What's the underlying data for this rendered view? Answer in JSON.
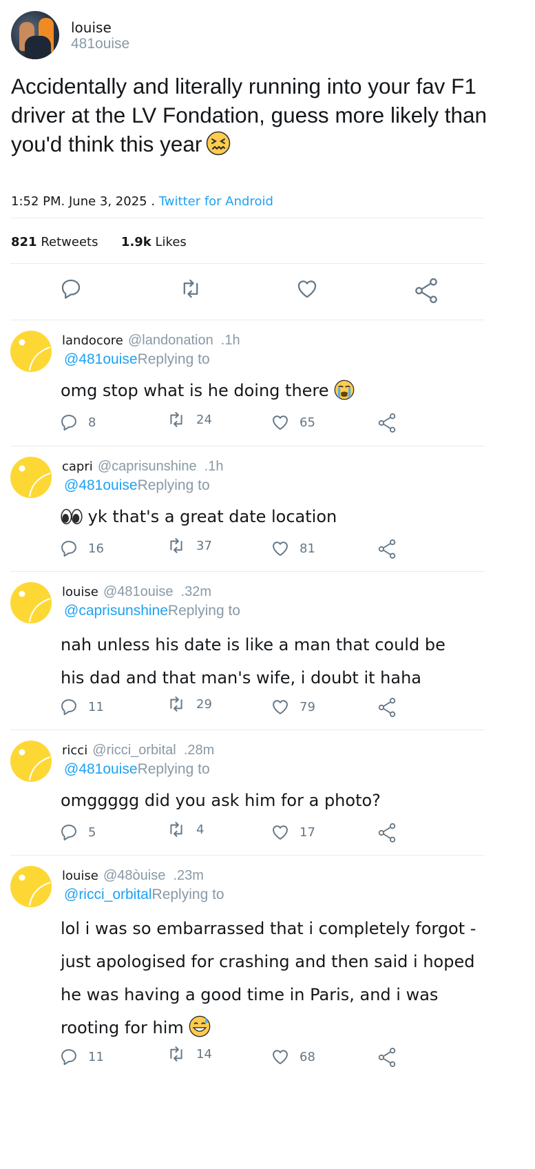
{
  "tweet": {
    "display_name": "louise",
    "handle": "481ouise",
    "text": "Accidentally and literally running into your fav F1 driver at the LV Fondation, guess more likely than you'd think this year",
    "emoji": "confounded-face-emoji",
    "timestamp": "1:52 PM. June 3, 2025 .",
    "source": "Twitter for Android",
    "retweets_count": "821",
    "retweets_label": "Retweets",
    "likes_count": "1.9k",
    "likes_label": "Likes",
    "actions": [
      "reply-icon",
      "retweet-icon",
      "like-icon",
      "share-icon"
    ]
  },
  "replies": [
    {
      "name": "landocore",
      "handle": "@landonation",
      "time": ".1h",
      "replying_handle": "@481ouise",
      "replying_label": "Replying to",
      "text": "omg stop what is he doing there",
      "emoji_after": "loudly-crying-face-emoji",
      "replies": "8",
      "retweets": "24",
      "likes": "65"
    },
    {
      "name": "capri",
      "handle": "@caprisunshine",
      "time": ".1h",
      "replying_handle": "@481ouise",
      "replying_label": "Replying to",
      "text": "yk that's a great date location",
      "emoji_before": "eyes-emoji",
      "replies": "16",
      "retweets": "37",
      "likes": "81"
    },
    {
      "name": "louise",
      "handle": "@481ouise",
      "time": ".32m",
      "replying_handle": "@caprisunshine",
      "replying_label": "Replying to",
      "text": "nah unless his date is like a man that could be his dad and that man's wife, i doubt it haha",
      "replies": "11",
      "retweets": "29",
      "likes": "79"
    },
    {
      "name": "ricci",
      "handle": "@ricci_orbital",
      "time": ".28m",
      "replying_handle": "@481ouise",
      "replying_label": "Replying to",
      "text": "omggggg did you ask him for a photo?",
      "replies": "5",
      "retweets": "4",
      "likes": "17"
    },
    {
      "name": "louise",
      "handle": "@48òuise",
      "time": ".23m",
      "replying_handle": "@ricci_orbital",
      "replying_label": "Replying to",
      "text": "lol i was so embarrassed that i completely forgot - just apologised for crashing and then said i hoped he was having a good time in Paris, and i was rooting for him",
      "emoji_after": "grinning-face-with-sweat-emoji",
      "replies": "11",
      "retweets": "14",
      "likes": "68"
    }
  ],
  "colors": {
    "link_blue": "#1da1f2",
    "muted_gray": "#8899a6",
    "icon_gray": "#657786",
    "divider": "#e6ecf0",
    "reply_avatar_yellow": "#fdd835"
  }
}
